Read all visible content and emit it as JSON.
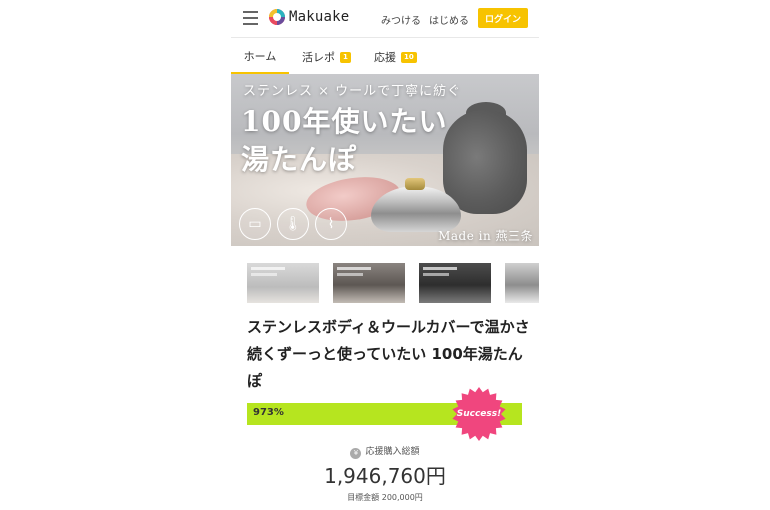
{
  "header": {
    "logo_text": "Makuake",
    "links": {
      "mitsukeru": "みつける",
      "hajimeru": "はじめる"
    },
    "login_label": "ログイン"
  },
  "tabs": [
    {
      "label": "ホーム",
      "badge": ""
    },
    {
      "label": "活レポ",
      "badge": "1"
    },
    {
      "label": "応援",
      "badge": "10"
    }
  ],
  "hero": {
    "subtitle": "ステンレス × ウールで丁寧に紡ぐ",
    "headline_line1": "100年使いたい",
    "headline_line2": "湯たんぽ",
    "made_in": "Made in 燕三条"
  },
  "project": {
    "title": "ステンレスボディ＆ウールカバーで温かさ続くずーっと使っていたい 100年湯たんぽ",
    "progress_text": "973%",
    "progress_fraction": 1.0,
    "success_label": "Success!",
    "total_label": "応援購入総額",
    "total_amount": "1,946,760円",
    "goal": "目標金額 200,000円"
  },
  "colors": {
    "accent": "#f7c300",
    "progress": "#b6e51f",
    "success": "#f0467e"
  }
}
